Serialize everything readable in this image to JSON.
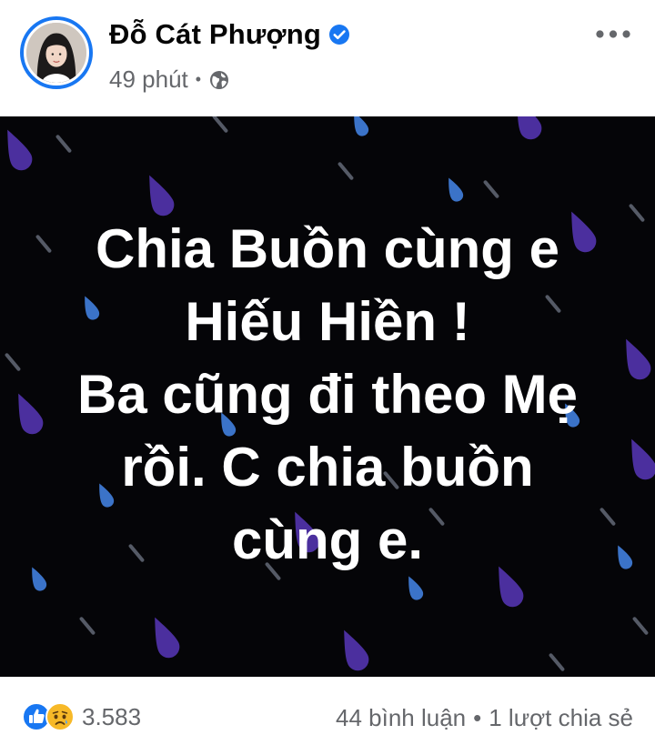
{
  "post": {
    "author": "Đỗ Cát Phượng",
    "time": "49 phút",
    "separator": "•",
    "privacy_icon": "globe-icon",
    "verified_icon": "verified-badge-icon",
    "more_icon": "more-options-icon"
  },
  "image_text": {
    "lines": [
      "Chia Buồn cùng e",
      "Hiếu Hiền !",
      "Ba cũng đi theo Mẹ",
      "rồi. C chia buồn",
      "cùng e."
    ]
  },
  "footer": {
    "reaction_icons": [
      "like-icon",
      "sad-icon"
    ],
    "reaction_count": "3.583",
    "comments": "44 bình luận",
    "separator": "•",
    "shares": "1 lượt chia sẻ"
  },
  "colors": {
    "brand_blue": "#1877f2",
    "secondary_text": "#65676b",
    "image_background": "#050508",
    "raindrop_purple": "#4b2f9e",
    "raindrop_blue": "#3b73c8",
    "sad_yellow": "#f7b928"
  }
}
